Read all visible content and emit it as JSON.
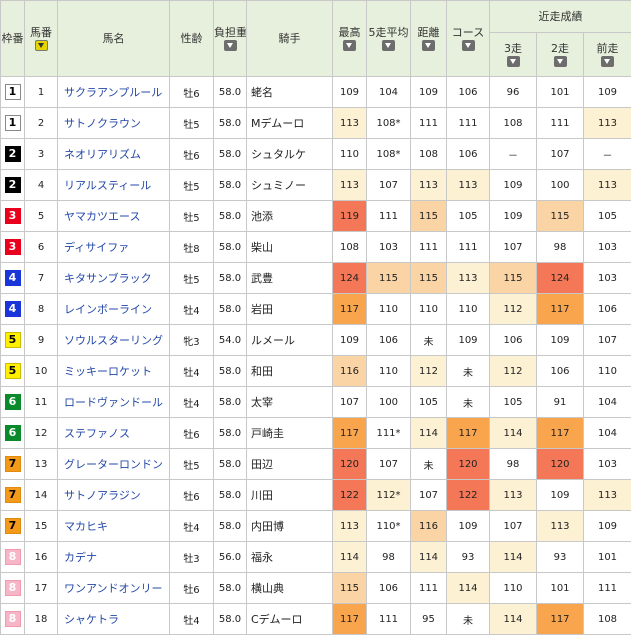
{
  "colors": {
    "header_bg": "#e7f0dc",
    "level1": "#fdf1d3",
    "level2": "#fbd4a6",
    "level3": "#f9a54d",
    "level4": "#f47857",
    "name_link": "#2448a8"
  },
  "headers": {
    "waku": "枠番",
    "umaban": "馬番",
    "name": "馬名",
    "sex_age": "性齢",
    "weight": "負担重量",
    "jockey": "騎手",
    "max": "最高",
    "avg5": "5走平均",
    "distance": "距離",
    "course": "コース",
    "recent_group": "近走成績",
    "r3": "3走",
    "r2": "2走",
    "r1": "前走"
  },
  "rows": [
    {
      "waku": "1",
      "umaban": "1",
      "name": "サクラアンプルール",
      "sex_age": "牡6",
      "weight": "58.0",
      "jockey": "蛯名",
      "max": "109",
      "avg5": "104",
      "dist": "109",
      "course": "106",
      "r3": "96",
      "r2": "101",
      "r1": "109"
    },
    {
      "waku": "1",
      "umaban": "2",
      "name": "サトノクラウン",
      "sex_age": "牡5",
      "weight": "58.0",
      "jockey": "Mデムーロ",
      "max": "113",
      "avg5": "108*",
      "dist": "111",
      "course": "111",
      "r3": "108",
      "r2": "111",
      "r1": "113"
    },
    {
      "waku": "2",
      "umaban": "3",
      "name": "ネオリアリズム",
      "sex_age": "牡6",
      "weight": "58.0",
      "jockey": "シュタルケ",
      "max": "110",
      "avg5": "108*",
      "dist": "108",
      "course": "106",
      "r3": "－",
      "r2": "107",
      "r1": "－"
    },
    {
      "waku": "2",
      "umaban": "4",
      "name": "リアルスティール",
      "sex_age": "牡5",
      "weight": "58.0",
      "jockey": "シュミノー",
      "max": "113",
      "avg5": "107",
      "dist": "113",
      "course": "113",
      "r3": "109",
      "r2": "100",
      "r1": "113"
    },
    {
      "waku": "3",
      "umaban": "5",
      "name": "ヤマカツエース",
      "sex_age": "牡5",
      "weight": "58.0",
      "jockey": "池添",
      "max": "119",
      "avg5": "111",
      "dist": "115",
      "course": "105",
      "r3": "109",
      "r2": "115",
      "r1": "105"
    },
    {
      "waku": "3",
      "umaban": "6",
      "name": "ディサイファ",
      "sex_age": "牡8",
      "weight": "58.0",
      "jockey": "柴山",
      "max": "108",
      "avg5": "103",
      "dist": "111",
      "course": "111",
      "r3": "107",
      "r2": "98",
      "r1": "103"
    },
    {
      "waku": "4",
      "umaban": "7",
      "name": "キタサンブラック",
      "sex_age": "牡5",
      "weight": "58.0",
      "jockey": "武豊",
      "max": "124",
      "avg5": "115",
      "dist": "115",
      "course": "113",
      "r3": "115",
      "r2": "124",
      "r1": "103"
    },
    {
      "waku": "4",
      "umaban": "8",
      "name": "レインボーライン",
      "sex_age": "牡4",
      "weight": "58.0",
      "jockey": "岩田",
      "max": "117",
      "avg5": "110",
      "dist": "110",
      "course": "110",
      "r3": "112",
      "r2": "117",
      "r1": "106"
    },
    {
      "waku": "5",
      "umaban": "9",
      "name": "ソウルスターリング",
      "sex_age": "牝3",
      "weight": "54.0",
      "jockey": "ルメール",
      "max": "109",
      "avg5": "106",
      "dist": "未",
      "course": "109",
      "r3": "106",
      "r2": "109",
      "r1": "107"
    },
    {
      "waku": "5",
      "umaban": "10",
      "name": "ミッキーロケット",
      "sex_age": "牡4",
      "weight": "58.0",
      "jockey": "和田",
      "max": "116",
      "avg5": "110",
      "dist": "112",
      "course": "未",
      "r3": "112",
      "r2": "106",
      "r1": "110"
    },
    {
      "waku": "6",
      "umaban": "11",
      "name": "ロードヴァンドール",
      "sex_age": "牡4",
      "weight": "58.0",
      "jockey": "太宰",
      "max": "107",
      "avg5": "100",
      "dist": "105",
      "course": "未",
      "r3": "105",
      "r2": "91",
      "r1": "104"
    },
    {
      "waku": "6",
      "umaban": "12",
      "name": "ステファノス",
      "sex_age": "牡6",
      "weight": "58.0",
      "jockey": "戸崎圭",
      "max": "117",
      "avg5": "111*",
      "dist": "114",
      "course": "117",
      "r3": "114",
      "r2": "117",
      "r1": "104"
    },
    {
      "waku": "7",
      "umaban": "13",
      "name": "グレーターロンドン",
      "sex_age": "牡5",
      "weight": "58.0",
      "jockey": "田辺",
      "max": "120",
      "avg5": "107",
      "dist": "未",
      "course": "120",
      "r3": "98",
      "r2": "120",
      "r1": "103"
    },
    {
      "waku": "7",
      "umaban": "14",
      "name": "サトノアラジン",
      "sex_age": "牡6",
      "weight": "58.0",
      "jockey": "川田",
      "max": "122",
      "avg5": "112*",
      "dist": "107",
      "course": "122",
      "r3": "113",
      "r2": "109",
      "r1": "113"
    },
    {
      "waku": "7",
      "umaban": "15",
      "name": "マカヒキ",
      "sex_age": "牡4",
      "weight": "58.0",
      "jockey": "内田博",
      "max": "113",
      "avg5": "110*",
      "dist": "116",
      "course": "109",
      "r3": "107",
      "r2": "113",
      "r1": "109"
    },
    {
      "waku": "8",
      "umaban": "16",
      "name": "カデナ",
      "sex_age": "牡3",
      "weight": "56.0",
      "jockey": "福永",
      "max": "114",
      "avg5": "98",
      "dist": "114",
      "course": "93",
      "r3": "114",
      "r2": "93",
      "r1": "101"
    },
    {
      "waku": "8",
      "umaban": "17",
      "name": "ワンアンドオンリー",
      "sex_age": "牡6",
      "weight": "58.0",
      "jockey": "横山典",
      "max": "115",
      "avg5": "106",
      "dist": "111",
      "course": "114",
      "r3": "110",
      "r2": "101",
      "r1": "111"
    },
    {
      "waku": "8",
      "umaban": "18",
      "name": "シャケトラ",
      "sex_age": "牡4",
      "weight": "58.0",
      "jockey": "Cデムーロ",
      "max": "117",
      "avg5": "111",
      "dist": "95",
      "course": "未",
      "r3": "114",
      "r2": "117",
      "r1": "108"
    }
  ]
}
